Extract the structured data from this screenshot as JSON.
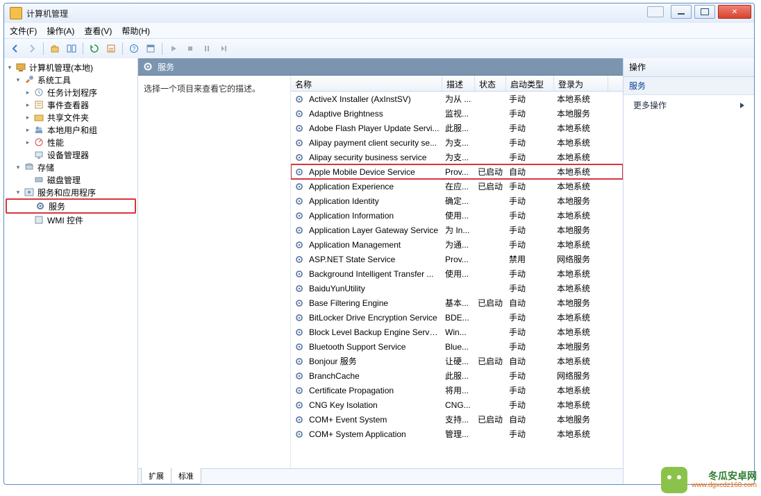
{
  "window": {
    "title": "计算机管理"
  },
  "menu": {
    "file": "文件(F)",
    "action": "操作(A)",
    "view": "查看(V)",
    "help": "帮助(H)"
  },
  "tree": {
    "root": "计算机管理(本地)",
    "system_tools": "系统工具",
    "task_scheduler": "任务计划程序",
    "event_viewer": "事件查看器",
    "shared_folders": "共享文件夹",
    "local_users": "本地用户和组",
    "performance": "性能",
    "device_manager": "设备管理器",
    "storage": "存储",
    "disk_mgmt": "磁盘管理",
    "services_apps": "服务和应用程序",
    "services": "服务",
    "wmi": "WMI 控件"
  },
  "center": {
    "heading": "服务",
    "desc_prompt": "选择一个项目来查看它的描述。",
    "columns": {
      "name": "名称",
      "desc": "描述",
      "status": "状态",
      "startup": "启动类型",
      "logon": "登录为"
    },
    "tabs": {
      "ext": "扩展",
      "std": "标准"
    }
  },
  "services": [
    {
      "name": "ActiveX Installer (AxInstSV)",
      "desc": "为从 ...",
      "status": "",
      "startup": "手动",
      "logon": "本地系统"
    },
    {
      "name": "Adaptive Brightness",
      "desc": "监视...",
      "status": "",
      "startup": "手动",
      "logon": "本地服务"
    },
    {
      "name": "Adobe Flash Player Update Servi...",
      "desc": "此服...",
      "status": "",
      "startup": "手动",
      "logon": "本地系统"
    },
    {
      "name": "Alipay payment client security se...",
      "desc": "为支...",
      "status": "",
      "startup": "手动",
      "logon": "本地系统"
    },
    {
      "name": "Alipay security business service",
      "desc": "为支...",
      "status": "",
      "startup": "手动",
      "logon": "本地系统"
    },
    {
      "name": "Apple Mobile Device Service",
      "desc": "Prov...",
      "status": "已启动",
      "startup": "自动",
      "logon": "本地系统",
      "hl": true
    },
    {
      "name": "Application Experience",
      "desc": "在应...",
      "status": "已启动",
      "startup": "手动",
      "logon": "本地系统"
    },
    {
      "name": "Application Identity",
      "desc": "确定...",
      "status": "",
      "startup": "手动",
      "logon": "本地服务"
    },
    {
      "name": "Application Information",
      "desc": "使用...",
      "status": "",
      "startup": "手动",
      "logon": "本地系统"
    },
    {
      "name": "Application Layer Gateway Service",
      "desc": "为 In...",
      "status": "",
      "startup": "手动",
      "logon": "本地服务"
    },
    {
      "name": "Application Management",
      "desc": "为通...",
      "status": "",
      "startup": "手动",
      "logon": "本地系统"
    },
    {
      "name": "ASP.NET State Service",
      "desc": "Prov...",
      "status": "",
      "startup": "禁用",
      "logon": "网络服务"
    },
    {
      "name": "Background Intelligent Transfer ...",
      "desc": "使用...",
      "status": "",
      "startup": "手动",
      "logon": "本地系统"
    },
    {
      "name": "BaiduYunUtility",
      "desc": "",
      "status": "",
      "startup": "手动",
      "logon": "本地系统"
    },
    {
      "name": "Base Filtering Engine",
      "desc": "基本...",
      "status": "已启动",
      "startup": "自动",
      "logon": "本地服务"
    },
    {
      "name": "BitLocker Drive Encryption Service",
      "desc": "BDE...",
      "status": "",
      "startup": "手动",
      "logon": "本地系统"
    },
    {
      "name": "Block Level Backup Engine Service",
      "desc": "Win...",
      "status": "",
      "startup": "手动",
      "logon": "本地系统"
    },
    {
      "name": "Bluetooth Support Service",
      "desc": "Blue...",
      "status": "",
      "startup": "手动",
      "logon": "本地服务"
    },
    {
      "name": "Bonjour 服务",
      "desc": "让硬...",
      "status": "已启动",
      "startup": "自动",
      "logon": "本地系统"
    },
    {
      "name": "BranchCache",
      "desc": "此服...",
      "status": "",
      "startup": "手动",
      "logon": "网络服务"
    },
    {
      "name": "Certificate Propagation",
      "desc": "将用...",
      "status": "",
      "startup": "手动",
      "logon": "本地系统"
    },
    {
      "name": "CNG Key Isolation",
      "desc": "CNG...",
      "status": "",
      "startup": "手动",
      "logon": "本地系统"
    },
    {
      "name": "COM+ Event System",
      "desc": "支持...",
      "status": "已启动",
      "startup": "自动",
      "logon": "本地服务"
    },
    {
      "name": "COM+ System Application",
      "desc": "管理...",
      "status": "",
      "startup": "手动",
      "logon": "本地系统"
    }
  ],
  "actions": {
    "header": "操作",
    "group": "服务",
    "more": "更多操作"
  },
  "watermark": {
    "brand": "冬瓜安卓网",
    "url": "www.dgxcdz168.com"
  }
}
